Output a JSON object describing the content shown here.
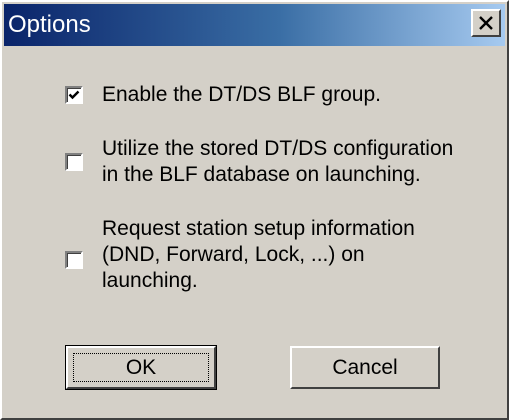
{
  "window": {
    "title": "Options"
  },
  "options": [
    {
      "lines": [
        "Enable the DT/DS BLF group."
      ],
      "checked": true
    },
    {
      "lines": [
        "Utilize the stored DT/DS configuration",
        "in the BLF database on launching."
      ],
      "checked": false
    },
    {
      "lines": [
        "Request station setup information",
        "(DND, Forward, Lock, ...) on",
        "launching."
      ],
      "checked": false
    }
  ],
  "buttons": {
    "ok_label": "OK",
    "cancel_label": "Cancel"
  },
  "icons": {
    "close": "close-icon",
    "check": "checkmark-icon"
  },
  "colors": {
    "titlebar_start": "#0a246a",
    "titlebar_end": "#a6caf0",
    "face": "#d4d0c8"
  }
}
